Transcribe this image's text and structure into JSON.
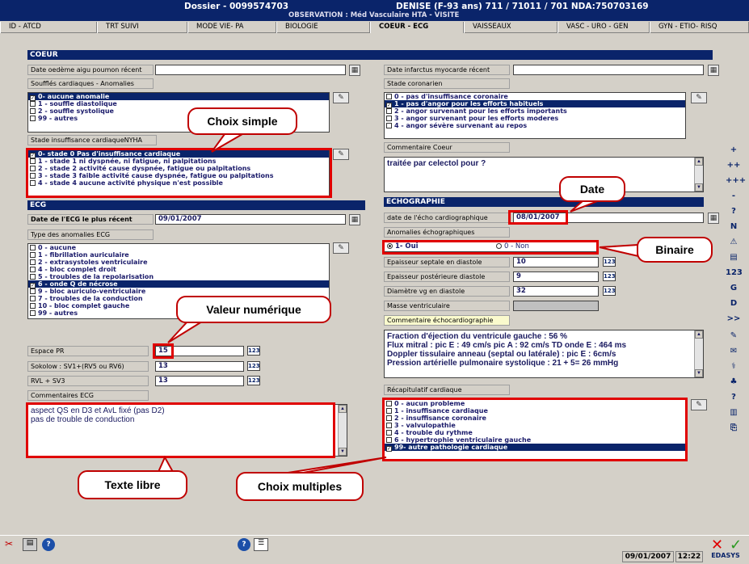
{
  "window": {
    "dossier": "Dossier - 0099574703",
    "patient": "DENISE (F-93 ans)  711 / 71011 / 701  NDA:750703169",
    "observation": "OBSERVATION : Méd Vasculaire HTA - VISITE"
  },
  "tabs": [
    "ID - ATCD",
    "TRT SUIVI",
    "MODE VIE- PA",
    "BIOLOGIE",
    "COEUR - ECG",
    "VAISSEAUX",
    "VASC - URO - GEN",
    "GYN - ETIO- RISQ"
  ],
  "active_tab": "COEUR - ECG",
  "coeur": {
    "header": "COEUR",
    "oap_label": "Date oedème aigu poumon récent",
    "oap_value": "",
    "souffles_label": "Soufflés cardiaques - Anomalies",
    "souffles": [
      {
        "label": "0- aucune anomalie",
        "checked": true,
        "selected": true
      },
      {
        "label": "1 - souffle diastolique",
        "checked": false
      },
      {
        "label": "2 - souffle systolique",
        "checked": false
      },
      {
        "label": "99 - autres",
        "checked": false
      }
    ],
    "nyha_label": "Stade insuffisance cardiaqueNYHA",
    "nyha": [
      {
        "label": "0- stade 0 Pas d'insuffisance cardiaque",
        "checked": true,
        "selected": true
      },
      {
        "label": "1 - stade 1 ni dyspnée, ni fatigue, ni palpitations",
        "checked": false
      },
      {
        "label": "2 - stade 2 activité cause dyspnée, fatigue ou palpitations",
        "checked": false
      },
      {
        "label": "3 - stade 3 faible activité cause dyspnée, fatigue ou palpitations",
        "checked": false
      },
      {
        "label": "4 - stade 4 aucune activité physique n'est possible",
        "checked": false
      }
    ],
    "infarctus_label": "Date infarctus myocarde récent",
    "infarctus_value": "",
    "coronarien_label": "Stade coronarien",
    "coronarien": [
      {
        "label": "0 - pas d'insuffisance coronaire",
        "checked": false
      },
      {
        "label": "1 - pas d'angor pour les efforts  habituels",
        "checked": true,
        "selected": true
      },
      {
        "label": "2 - angor survenant pour les efforts importants",
        "checked": false
      },
      {
        "label": "3 - angor survenant pour les efforts moderes",
        "checked": false
      },
      {
        "label": "4 - angor sévère survenant au repos",
        "checked": false
      }
    ],
    "commentaire_label": "Commentaire Coeur",
    "commentaire": "traitée par celectol pour ?"
  },
  "ecg": {
    "header": "ECG",
    "date_label": "Date de l'ECG le plus récent",
    "date_value": "09/01/2007",
    "types_label": "Type des anomalies ECG",
    "types": [
      {
        "label": "0 - aucune",
        "checked": false
      },
      {
        "label": "1 - fibrillation auriculaire",
        "checked": false
      },
      {
        "label": "2 - extrasystoles ventriculaire",
        "checked": false
      },
      {
        "label": "4 - bloc complet droit",
        "checked": false
      },
      {
        "label": "5 - troubles de la repolarisation",
        "checked": false
      },
      {
        "label": "6 - onde Q de nécrose",
        "checked": true,
        "selected": true
      },
      {
        "label": "9 - bloc auriculo-ventriculaire",
        "checked": false
      },
      {
        "label": "7 - troubles de la conduction",
        "checked": false
      },
      {
        "label": "10 - bloc complet gauche",
        "checked": false
      },
      {
        "label": "99 - autres",
        "checked": false
      }
    ],
    "pr_label": "Espace PR",
    "pr_value": "15",
    "sokolow_label": "Sokolow : SV1+(RV5 ou RV6)",
    "sokolow_value": "13",
    "rvl_label": "RVL + SV3",
    "rvl_value": "13",
    "comments_label": "Commentaires ECG",
    "comments_line1": "aspect QS en D3 et AvL  fixé (pas D2)",
    "comments_line2": "pas de trouble de conduction"
  },
  "echo": {
    "header": "ECHOGRAPHIE",
    "date_label": "date de l'écho cardiographique",
    "date_value": "08/01/2007",
    "anomalies_label": "Anomalies échographiques",
    "oui": "1- Oui",
    "non": "0 - Non",
    "septale_label": "Epaisseur septale en diastole",
    "septale_value": "10",
    "post_label": "Epaisseur postérieure diastole",
    "post_value": "9",
    "diam_label": "Diamètre vg en diastole",
    "diam_value": "32",
    "masse_label": "Masse ventriculaire",
    "masse_value": "",
    "comment_label": "Commentaire échocardiographie",
    "comment_lines": [
      "Fraction d'éjection du ventricule gauche : 56 %",
      "Flux mitral : pic E : 49 cm/s pic A : 92 cm/s TD onde E : 464 ms",
      "Doppler tissulaire anneau (septal ou latérale) : pic E : 6cm/s",
      "Pression artérielle pulmonaire systolique : 21 + 5= 26 mmHg"
    ],
    "recap_label": "Récapitulatif cardiaque",
    "recap": [
      {
        "label": "0 - aucun probleme",
        "checked": false
      },
      {
        "label": "1 - insuffisance cardiaque",
        "checked": false
      },
      {
        "label": "2 - insuffisance coronaire",
        "checked": false
      },
      {
        "label": "3 - valvulopathie",
        "checked": false
      },
      {
        "label": "4 - trouble du rythme",
        "checked": false
      },
      {
        "label": "6 - hypertrophie ventriculaire gauche",
        "checked": false
      },
      {
        "label": "99- autre pathologie cardiaque",
        "checked": true,
        "selected": true
      }
    ]
  },
  "callouts": {
    "choix_simple": "Choix simple",
    "date": "Date",
    "binaire": "Binaire",
    "valeur": "Valeur numérique",
    "texte": "Texte libre",
    "multiples": "Choix multiples"
  },
  "btn123": "123",
  "right_toolbar": [
    "+",
    "++",
    "+++",
    "-",
    "?",
    "N",
    "⚠",
    "▤",
    "123",
    "G",
    "D",
    ">>"
  ],
  "status": {
    "date": "09/01/2007",
    "time": "12:22",
    "brand": "EDASYS"
  }
}
